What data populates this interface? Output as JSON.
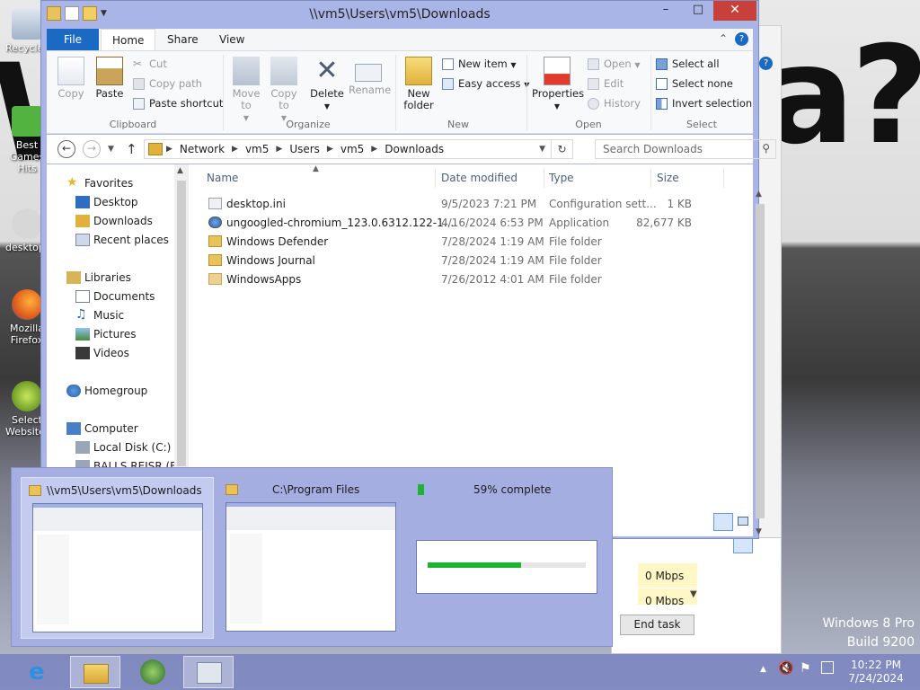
{
  "explorer": {
    "title": "\\\\vm5\\Users\\vm5\\Downloads",
    "tabs": {
      "file": "File",
      "home": "Home",
      "share": "Share",
      "view": "View"
    },
    "ribbon": {
      "clipboard": {
        "label": "Clipboard",
        "copy": "Copy",
        "paste": "Paste",
        "cut": "Cut",
        "copy_path": "Copy path",
        "paste_shortcut": "Paste shortcut"
      },
      "organize": {
        "label": "Organize",
        "move_to": "Move to",
        "copy_to": "Copy to",
        "delete": "Delete",
        "rename": "Rename"
      },
      "new": {
        "label": "New",
        "new_folder": "New folder",
        "new_item": "New item",
        "easy_access": "Easy access"
      },
      "open": {
        "label": "Open",
        "properties": "Properties",
        "open": "Open",
        "edit": "Edit",
        "history": "History"
      },
      "select": {
        "label": "Select",
        "select_all": "Select all",
        "select_none": "Select none",
        "invert_selection": "Invert selection"
      }
    },
    "address": {
      "crumbs": [
        "Network",
        "vm5",
        "Users",
        "vm5",
        "Downloads"
      ],
      "search_placeholder": "Search Downloads"
    },
    "nav": {
      "favorites": "Favorites",
      "desktop": "Desktop",
      "downloads": "Downloads",
      "recent": "Recent places",
      "libraries": "Libraries",
      "documents": "Documents",
      "music": "Music",
      "pictures": "Pictures",
      "videos": "Videos",
      "homegroup": "Homegroup",
      "computer": "Computer",
      "local_disk": "Local Disk (C:)",
      "drive_e": "BALLS REISR (E:)"
    },
    "columns": {
      "name": "Name",
      "date": "Date modified",
      "type": "Type",
      "size": "Size"
    },
    "files": [
      {
        "name": "desktop.ini",
        "date": "9/5/2023 7:21 PM",
        "type": "Configuration sett...",
        "size": "1 KB"
      },
      {
        "name": "ungoogled-chromium_123.0.6312.122-1....",
        "date": "4/16/2024 6:53 PM",
        "type": "Application",
        "size": "82,677 KB"
      },
      {
        "name": "Windows Defender",
        "date": "7/28/2024 1:19 AM",
        "type": "File folder",
        "size": ""
      },
      {
        "name": "Windows Journal",
        "date": "7/28/2024 1:19 AM",
        "type": "File folder",
        "size": ""
      },
      {
        "name": "WindowsApps",
        "date": "7/26/2012 4:01 AM",
        "type": "File folder",
        "size": ""
      }
    ]
  },
  "thumbnails": {
    "items": [
      {
        "title": "\\\\vm5\\Users\\vm5\\Downloads"
      },
      {
        "title": "C:\\Program Files"
      },
      {
        "title": "59% complete"
      }
    ],
    "copy_progress": 0.59
  },
  "taskmanager": {
    "mbps_1": "0 Mbps",
    "mbps_2": "0 Mbps",
    "end_task": "End task"
  },
  "desktop": {
    "icons": [
      "Recycle Bin",
      "Best Games Hits",
      "desktop.ini",
      "Mozilla Firefox",
      "Select Websites"
    ],
    "watermark_line1": "Windows 8 Pro",
    "watermark_line2": "Build 9200"
  },
  "taskbar": {
    "time": "10:22 PM",
    "date": "7/24/2024"
  },
  "colors": {
    "accent": "#1a6ac4",
    "window_frame": "#a9b5e6",
    "progress": "#1fb233",
    "close": "#c7413a"
  }
}
